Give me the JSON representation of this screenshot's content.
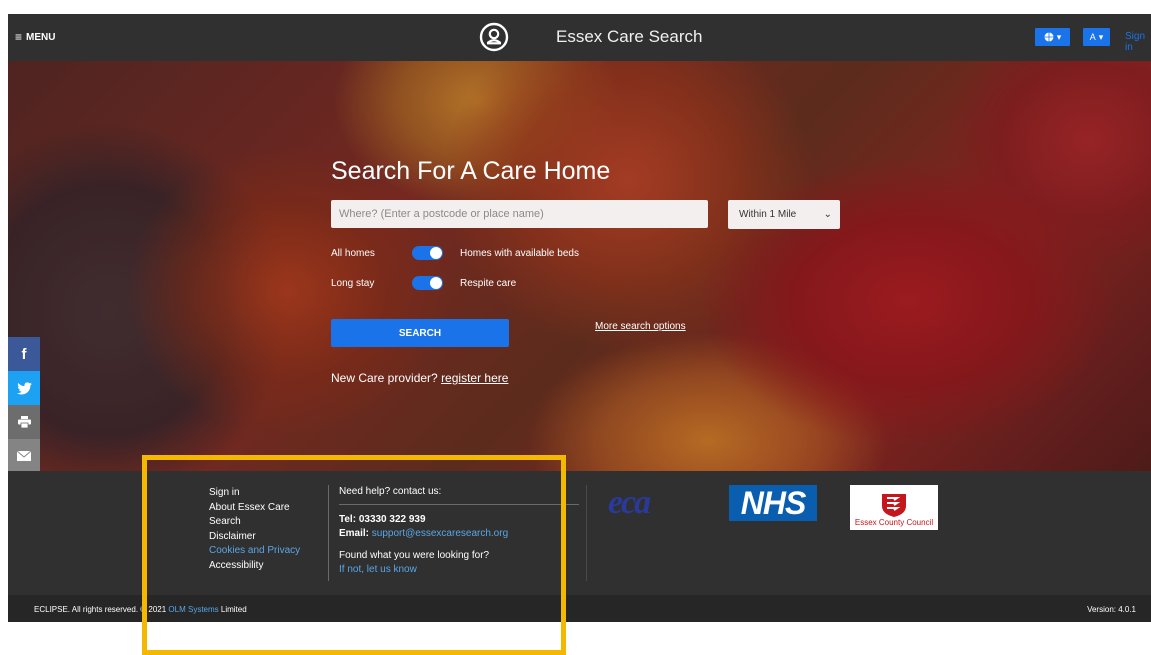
{
  "header": {
    "menu_label": "MENU",
    "title": "Essex Care Search",
    "lang_button_icon": "globe-icon",
    "text_size_label": "A",
    "signin_label": "Sign in"
  },
  "hero": {
    "heading": "Search For A Care Home",
    "search_placeholder": "Where? (Enter a postcode or place name)",
    "radius_selected": "Within 1 Mile",
    "toggles": [
      {
        "left_label": "All homes",
        "right_label": "Homes with available beds",
        "state": "on"
      },
      {
        "left_label": "Long stay",
        "right_label": "Respite care",
        "state": "on"
      }
    ],
    "search_button": "SEARCH",
    "more_options": "More search options",
    "provider_text": "New Care provider?",
    "provider_link": "register here"
  },
  "social": [
    {
      "icon": "facebook-icon",
      "glyph": "f",
      "color": "#3b5998"
    },
    {
      "icon": "twitter-icon",
      "glyph": "🐦",
      "color": "#1da1f2"
    },
    {
      "icon": "print-icon",
      "glyph": "⎙",
      "color": "#6d6d6d"
    },
    {
      "icon": "email-icon",
      "glyph": "✉",
      "color": "#848484"
    },
    {
      "icon": "share-plus-icon",
      "glyph": "+",
      "color": "#f05a40"
    }
  ],
  "footer": {
    "links": [
      {
        "label": "Sign in",
        "style": "white"
      },
      {
        "label": "About Essex Care Search",
        "style": "white"
      },
      {
        "label": "Disclaimer",
        "style": "white"
      },
      {
        "label": "Cookies and Privacy",
        "style": "blue"
      },
      {
        "label": "Accessibility",
        "style": "white"
      }
    ],
    "contact_heading": "Need help? contact us:",
    "tel": "Tel: 03330 322 939",
    "email_label": "Email:",
    "email": "support@essexcaresearch.org",
    "found_question": "Found what you were looking for?",
    "found_link": "If not, let us know",
    "logos": {
      "eca": "eca",
      "nhs": "NHS",
      "ecc": "Essex County Council"
    }
  },
  "bottom": {
    "copyright_prefix": "ECLIPSE. All rights reserved. © 2021",
    "company_link": "OLM Systems",
    "copyright_suffix": "Limited",
    "version": "Version: 4.0.1"
  },
  "colors": {
    "accent": "#1a73e8",
    "highlight": "#f5b800",
    "footer_bg": "#303030"
  }
}
